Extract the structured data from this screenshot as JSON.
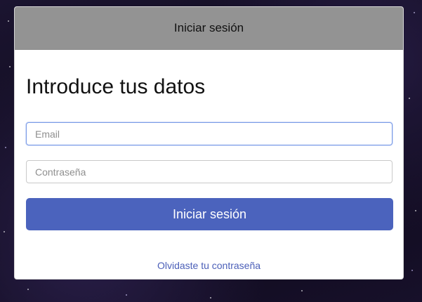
{
  "header": {
    "title": "Iniciar sesión"
  },
  "form": {
    "heading": "Introduce tus datos",
    "email_placeholder": "Email",
    "email_value": "",
    "password_placeholder": "Contraseña",
    "password_value": "",
    "submit_label": "Iniciar sesión",
    "forgot_link": "Olvidaste tu contraseña"
  },
  "colors": {
    "header_bg": "#939393",
    "primary_button": "#4b63bd",
    "link": "#4b5fb8",
    "focus_border": "#7a9be6"
  }
}
